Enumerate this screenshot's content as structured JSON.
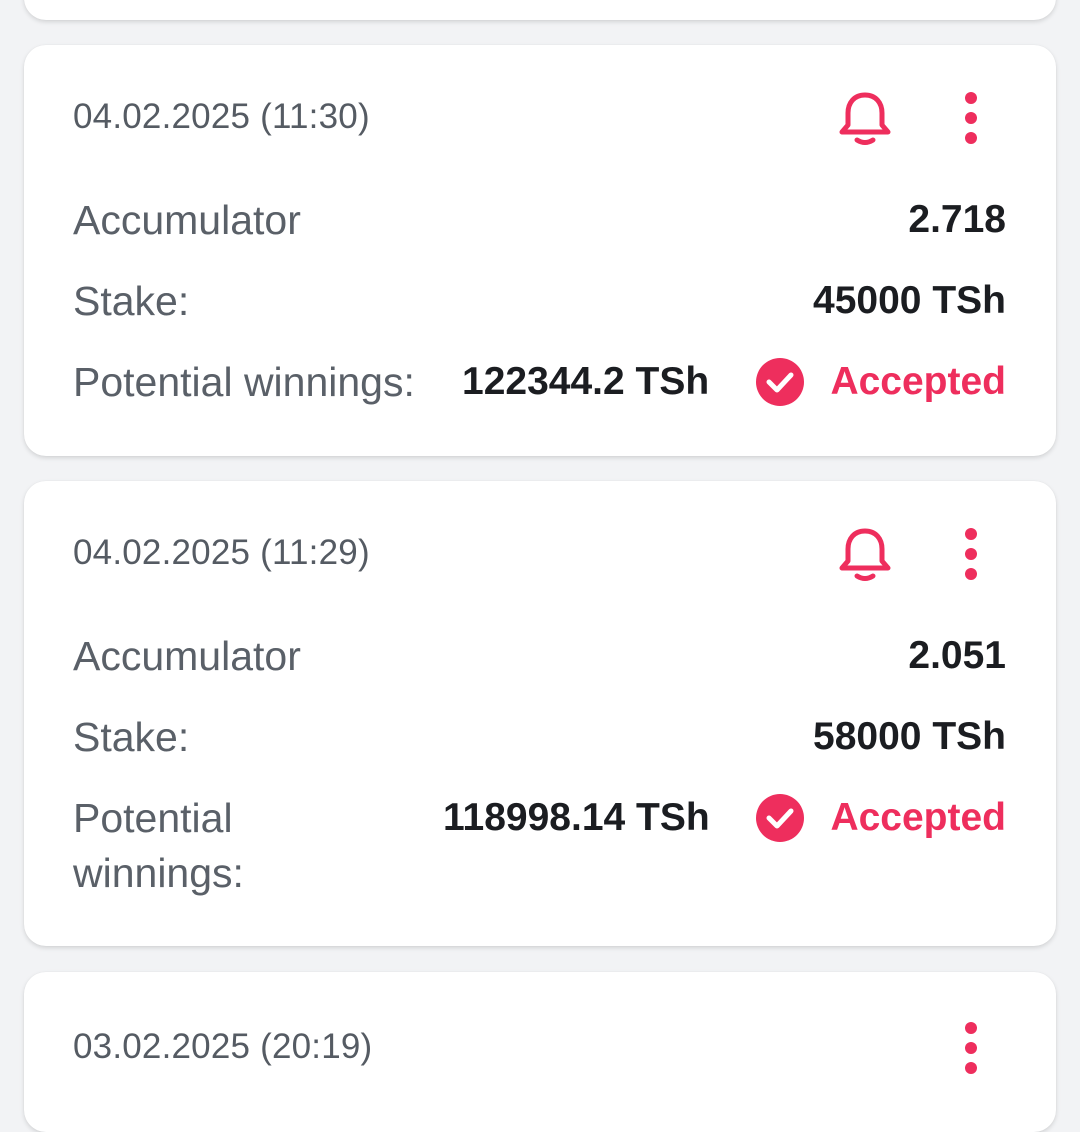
{
  "colors": {
    "accent": "#ee2e5d",
    "background": "#f2f3f5",
    "card": "#ffffff",
    "label_text": "#5a6068",
    "value_text": "#1b1d21"
  },
  "icons": {
    "notify": "bell-icon",
    "menu": "more-vertical-icon",
    "status": "check-circle-icon"
  },
  "bets": [
    {
      "datetime": "04.02.2025 (11:30)",
      "type": "Accumulator",
      "odds": "2.718",
      "stake_label": "Stake:",
      "stake": "45000 TSh",
      "winnings_label": "Potential winnings:",
      "winnings": "122344.2 TSh",
      "status": "Accepted"
    },
    {
      "datetime": "04.02.2025 (11:29)",
      "type": "Accumulator",
      "odds": "2.051",
      "stake_label": "Stake:",
      "stake": "58000 TSh",
      "winnings_label_line1": "Potential",
      "winnings_label_line2": "winnings:",
      "winnings": "118998.14 TSh",
      "status": "Accepted"
    },
    {
      "datetime": "03.02.2025 (20:19)"
    }
  ]
}
